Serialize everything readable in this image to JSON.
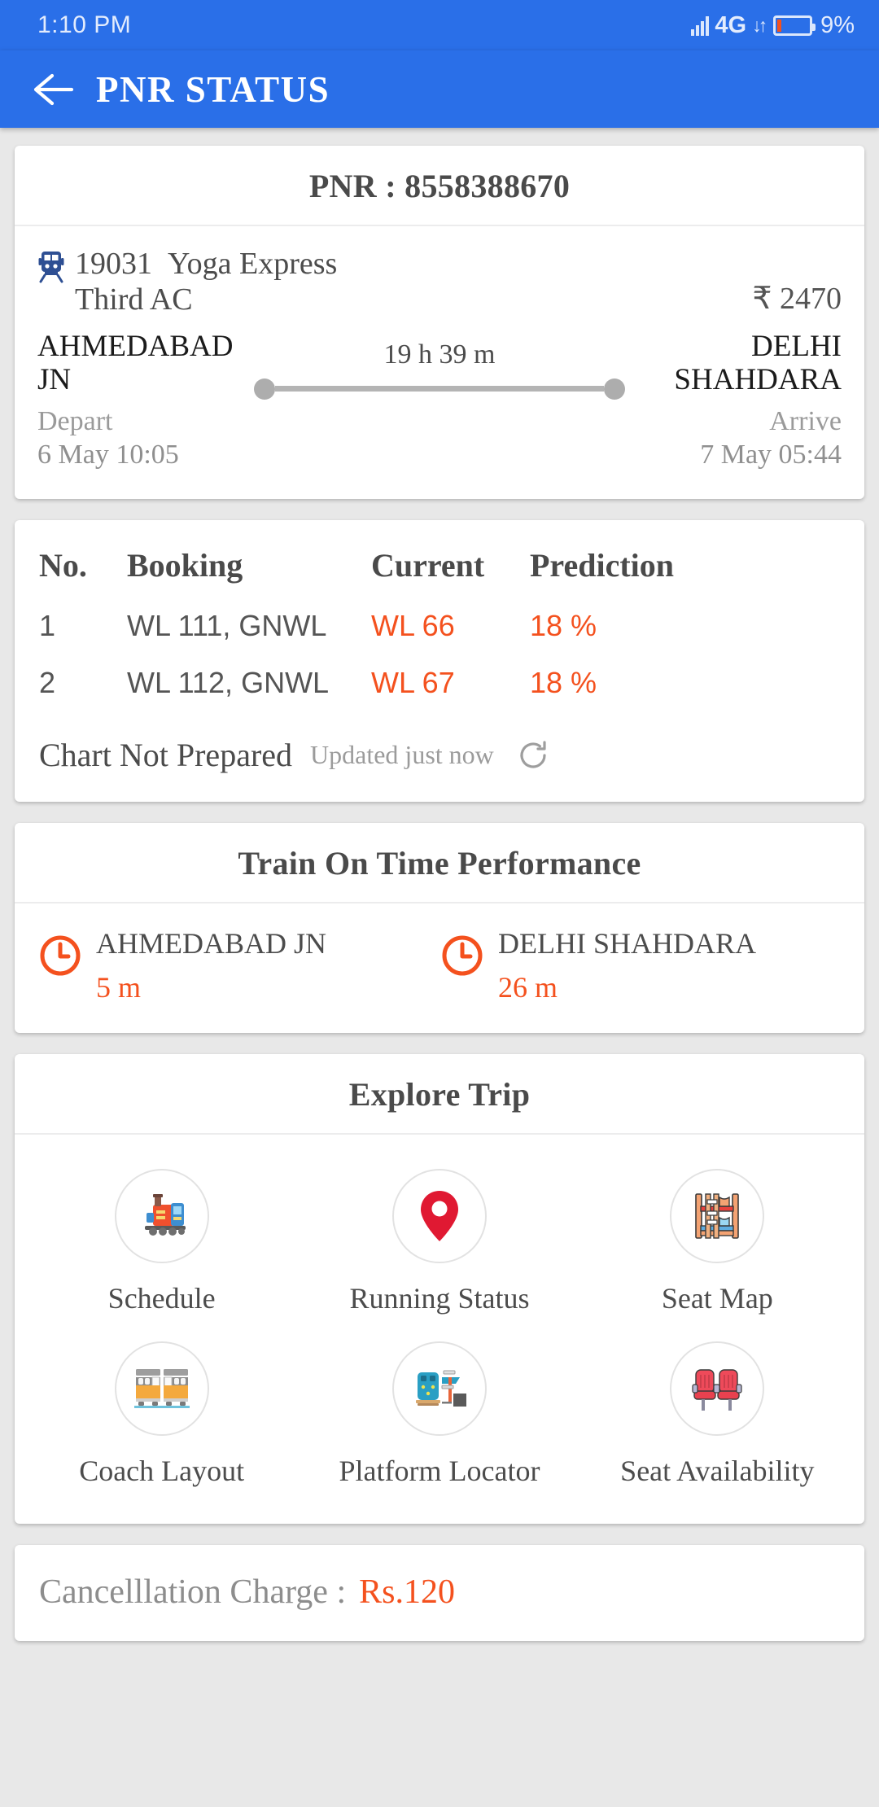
{
  "status_bar": {
    "time": "1:10 PM",
    "network_type": "4G",
    "battery_percent": "9%",
    "signal_icon": "signal-bars-icon",
    "data_arrows_icon": "data-transfer-icon",
    "battery_icon": "battery-low-icon"
  },
  "app_bar": {
    "back_icon": "back-arrow-icon",
    "title": "PNR STATUS"
  },
  "pnr_card": {
    "header": "PNR : 8558388670",
    "train_icon": "train-icon",
    "train_number": "19031",
    "train_name": "Yoga Express",
    "travel_class": "Third AC",
    "fare": "₹ 2470",
    "from_station": "AHMEDABAD JN",
    "to_station": "DELHI SHAHDARA",
    "duration": "19 h 39 m",
    "depart_label": "Depart",
    "depart_time": "6 May  10:05",
    "arrive_label": "Arrive",
    "arrive_time": "7 May  05:44"
  },
  "status_table": {
    "columns": [
      "No.",
      "Booking",
      "Current",
      "Prediction"
    ],
    "rows": [
      {
        "no": "1",
        "booking": "WL 111, GNWL",
        "current": "WL 66",
        "prediction": "18 %"
      },
      {
        "no": "2",
        "booking": "WL 112, GNWL",
        "current": "WL 67",
        "prediction": "18 %"
      }
    ],
    "chart_status": "Chart Not Prepared",
    "updated_text": "Updated just now",
    "refresh_icon": "refresh-icon"
  },
  "on_time_performance": {
    "header": "Train On Time Performance",
    "items": [
      {
        "icon": "clock-icon",
        "station": "AHMEDABAD JN",
        "delay": "5 m"
      },
      {
        "icon": "clock-icon",
        "station": "DELHI SHAHDARA",
        "delay": "26 m"
      }
    ]
  },
  "explore_trip": {
    "header": "Explore Trip",
    "tiles": [
      {
        "icon": "locomotive-icon",
        "label": "Schedule"
      },
      {
        "icon": "map-pin-icon",
        "label": "Running Status"
      },
      {
        "icon": "bunk-bed-icon",
        "label": "Seat Map"
      },
      {
        "icon": "coach-icon",
        "label": "Coach Layout"
      },
      {
        "icon": "platform-icon",
        "label": "Platform Locator"
      },
      {
        "icon": "seats-icon",
        "label": "Seat Availability"
      }
    ]
  },
  "cancellation": {
    "label": "Cancelllation Charge :",
    "value": "Rs.120"
  },
  "colors": {
    "brand_blue": "#2a6fe8",
    "accent_orange": "#f4511e",
    "page_bg": "#e8e8e8",
    "card_bg": "#ffffff"
  }
}
